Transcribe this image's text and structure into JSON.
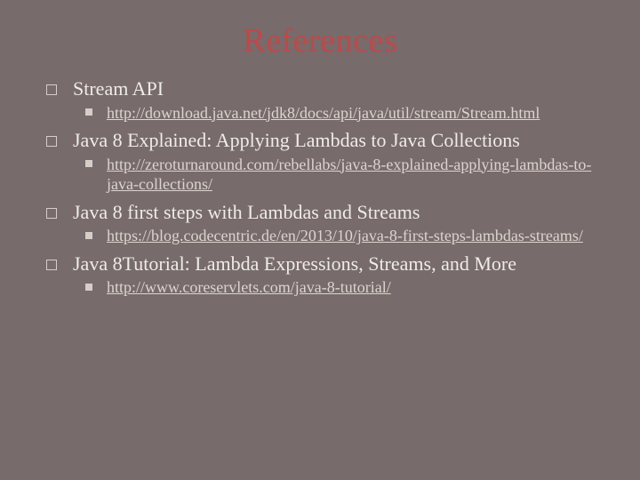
{
  "title": "References",
  "items": [
    {
      "heading": "Stream API",
      "links": [
        "http://download.java.net/jdk8/docs/api/java/util/stream/Stream.html"
      ]
    },
    {
      "heading": "Java 8 Explained: Applying Lambdas to Java Collections",
      "links": [
        "http://zeroturnaround.com/rebellabs/java-8-explained-applying-lambdas-to-java-collections/"
      ]
    },
    {
      "heading": "Java 8 first steps with Lambdas and Streams",
      "links": [
        "https://blog.codecentric.de/en/2013/10/java-8-first-steps-lambdas-streams/"
      ]
    },
    {
      "heading": "Java 8Tutorial: Lambda Expressions, Streams, and More",
      "links": [
        "http://www.coreservlets.com/java-8-tutorial/"
      ]
    }
  ]
}
